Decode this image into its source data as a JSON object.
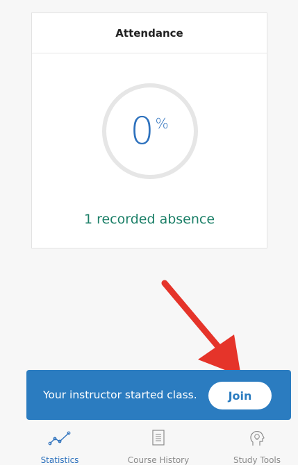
{
  "attendance_card": {
    "title": "Attendance",
    "percent_value": "0",
    "percent_sign": "%",
    "absence_text": "1 recorded absence"
  },
  "banner": {
    "message": "Your instructor started class.",
    "join_label": "Join"
  },
  "tabbar": {
    "tabs": [
      {
        "label": "Statistics",
        "icon": "line-chart-icon",
        "active": true
      },
      {
        "label": "Course History",
        "icon": "document-list-icon",
        "active": false
      },
      {
        "label": "Study Tools",
        "icon": "head-lightbulb-icon",
        "active": false
      }
    ]
  },
  "colors": {
    "accent": "#2d71bd",
    "banner_bg": "#2b7cc0",
    "absence_text": "#1b7f67",
    "arrow": "#e5342a"
  }
}
